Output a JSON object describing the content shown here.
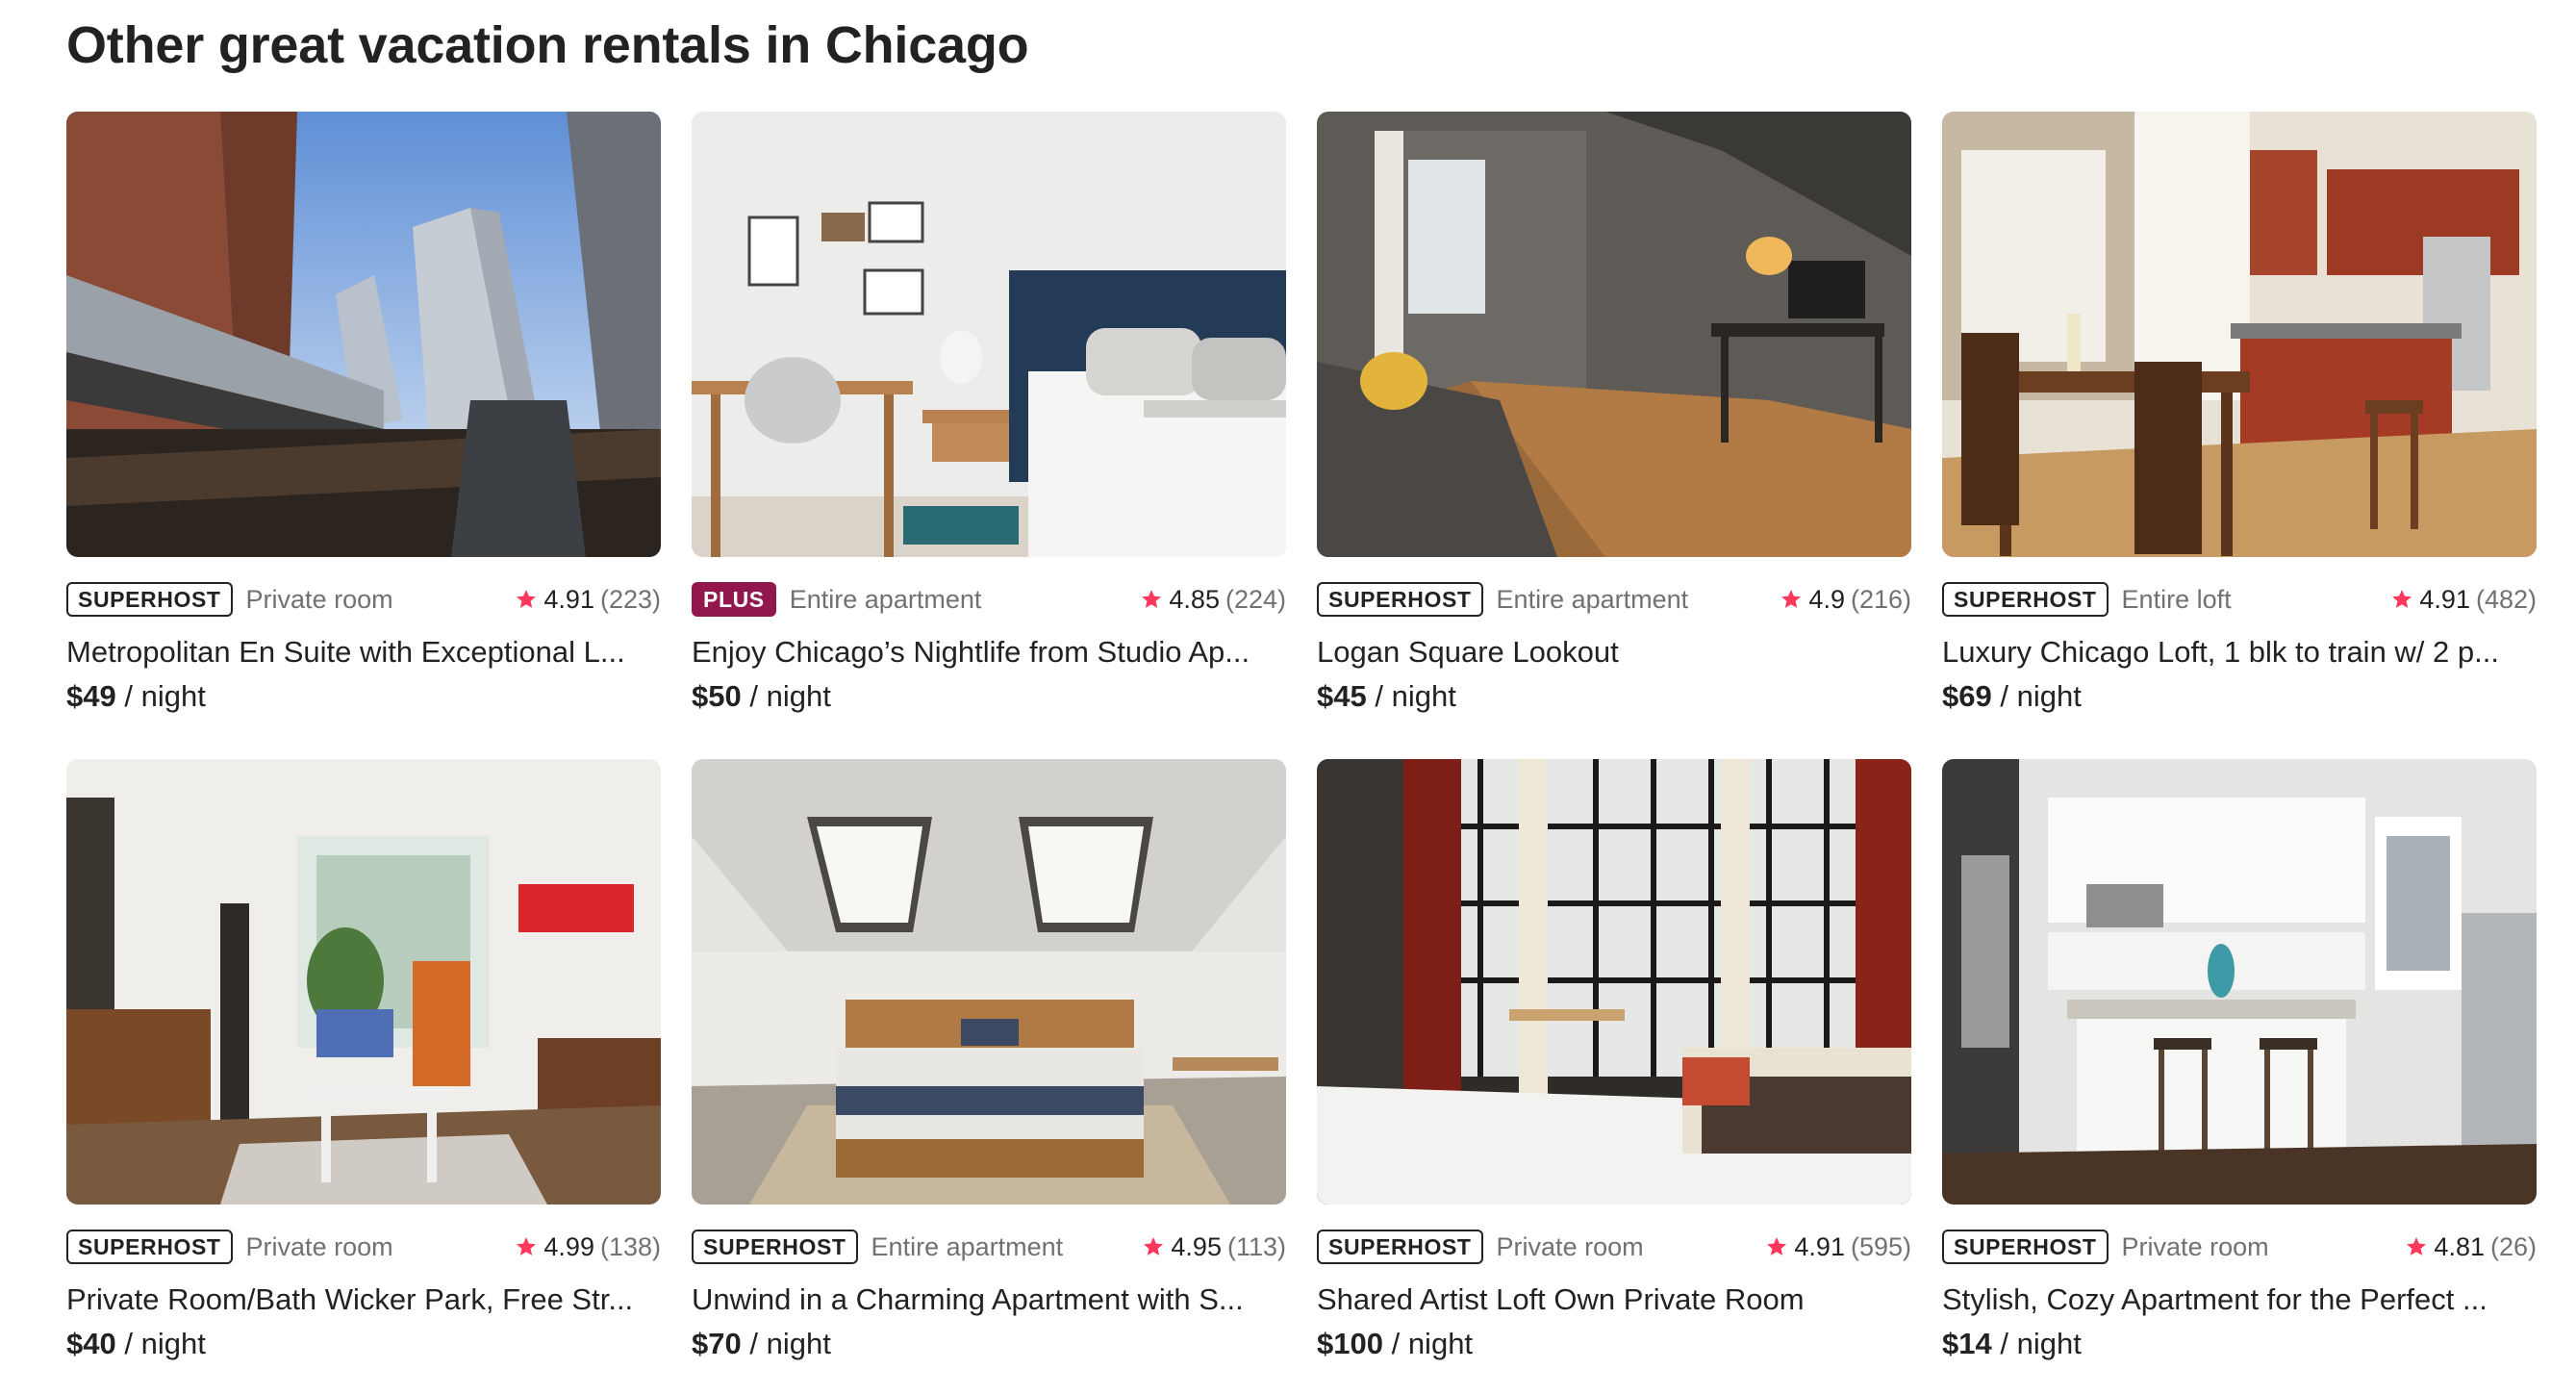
{
  "section": {
    "title": "Other great vacation rentals in Chicago"
  },
  "listings": [
    {
      "badge": "SUPERHOST",
      "badge_style": "superhost",
      "type": "Private room",
      "rating": "4.91",
      "reviews": "(223)",
      "title": "Metropolitan En Suite with Exceptional L...",
      "price": "$49",
      "unit": "/ night"
    },
    {
      "badge": "PLUS",
      "badge_style": "plus",
      "type": "Entire apartment",
      "rating": "4.85",
      "reviews": "(224)",
      "title": "Enjoy Chicago’s Nightlife from Studio Ap...",
      "price": "$50",
      "unit": "/ night"
    },
    {
      "badge": "SUPERHOST",
      "badge_style": "superhost",
      "type": "Entire apartment",
      "rating": "4.9",
      "reviews": "(216)",
      "title": "Logan Square Lookout",
      "price": "$45",
      "unit": "/ night"
    },
    {
      "badge": "SUPERHOST",
      "badge_style": "superhost",
      "type": "Entire loft",
      "rating": "4.91",
      "reviews": "(482)",
      "title": "Luxury Chicago Loft, 1 blk to train w/ 2 p...",
      "price": "$69",
      "unit": "/ night"
    },
    {
      "badge": "SUPERHOST",
      "badge_style": "superhost",
      "type": "Private room",
      "rating": "4.99",
      "reviews": "(138)",
      "title": "Private Room/Bath Wicker Park, Free Str...",
      "price": "$40",
      "unit": "/ night"
    },
    {
      "badge": "SUPERHOST",
      "badge_style": "superhost",
      "type": "Entire apartment",
      "rating": "4.95",
      "reviews": "(113)",
      "title": "Unwind in a Charming Apartment with S...",
      "price": "$70",
      "unit": "/ night"
    },
    {
      "badge": "SUPERHOST",
      "badge_style": "superhost",
      "type": "Private room",
      "rating": "4.91",
      "reviews": "(595)",
      "title": "Shared Artist Loft Own Private Room",
      "price": "$100",
      "unit": "/ night"
    },
    {
      "badge": "SUPERHOST",
      "badge_style": "superhost",
      "type": "Private room",
      "rating": "4.81",
      "reviews": "(26)",
      "title": "Stylish, Cozy Apartment for the Perfect ...",
      "price": "$14",
      "unit": "/ night"
    }
  ],
  "colors": {
    "text": "#222222",
    "muted": "#717171",
    "star": "#ff385c",
    "plus_badge": "#92174d"
  },
  "icons": {
    "rating": "star-icon"
  }
}
